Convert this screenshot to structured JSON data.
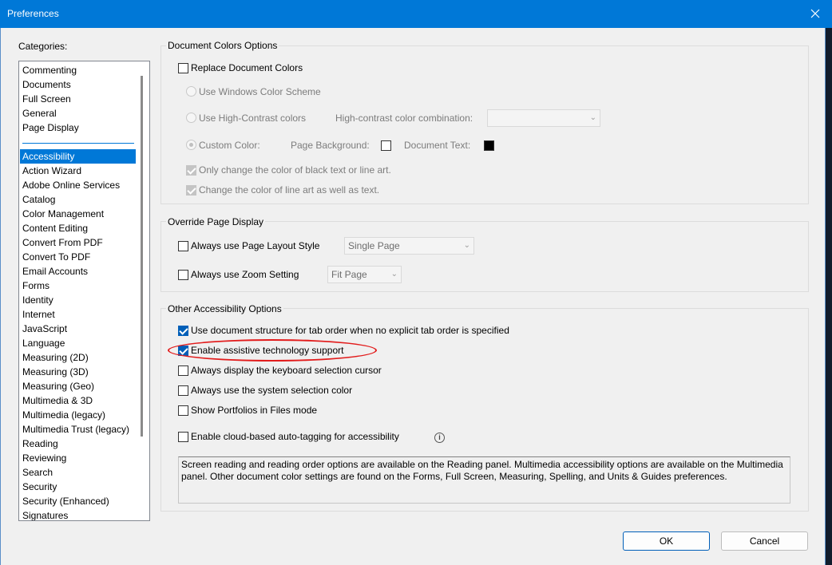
{
  "window": {
    "title": "Preferences",
    "accent": "#0078d7"
  },
  "categories": {
    "label": "Categories:",
    "top_items": [
      "Commenting",
      "Documents",
      "Full Screen",
      "General",
      "Page Display"
    ],
    "items": [
      "Accessibility",
      "Action Wizard",
      "Adobe Online Services",
      "Catalog",
      "Color Management",
      "Content Editing",
      "Convert From PDF",
      "Convert To PDF",
      "Email Accounts",
      "Forms",
      "Identity",
      "Internet",
      "JavaScript",
      "Language",
      "Measuring (2D)",
      "Measuring (3D)",
      "Measuring (Geo)",
      "Multimedia & 3D",
      "Multimedia (legacy)",
      "Multimedia Trust (legacy)",
      "Reading",
      "Reviewing",
      "Search",
      "Security",
      "Security (Enhanced)",
      "Signatures"
    ],
    "selected": "Accessibility"
  },
  "doc_colors": {
    "title": "Document Colors Options",
    "replace_label": "Replace Document Colors",
    "replace_checked": false,
    "use_windows_label": "Use Windows Color Scheme",
    "use_high_contrast_label": "Use High-Contrast colors",
    "high_contrast_combo_label": "High-contrast color combination:",
    "high_contrast_combo_value": "",
    "custom_color_label": "Custom Color:",
    "page_background_label": "Page Background:",
    "page_background_color": "#ffffff",
    "document_text_label": "Document Text:",
    "document_text_color": "#000000",
    "only_black_label": "Only change the color of black text or line art.",
    "line_art_label": "Change the color of line art as well as text."
  },
  "override": {
    "title": "Override Page Display",
    "page_layout_label": "Always use Page Layout Style",
    "page_layout_value": "Single Page",
    "zoom_label": "Always use Zoom Setting",
    "zoom_value": "Fit Page"
  },
  "other": {
    "title": "Other Accessibility Options",
    "options": [
      {
        "label": "Use document structure for tab order when no explicit tab order is specified",
        "checked": true
      },
      {
        "label": "Enable assistive technology support",
        "checked": true
      },
      {
        "label": "Always display the keyboard selection cursor",
        "checked": false
      },
      {
        "label": "Always use the system selection color",
        "checked": false
      },
      {
        "label": "Show Portfolios in Files mode",
        "checked": false
      }
    ],
    "cloud_label": "Enable cloud-based auto-tagging for accessibility",
    "cloud_checked": false,
    "info_icon": "info-icon",
    "note": "Screen reading and reading order options are available on the Reading panel. Multimedia accessibility options are available on the Multimedia panel. Other document color settings are found on the Forms, Full Screen, Measuring, Spelling, and Units & Guides preferences."
  },
  "buttons": {
    "ok": "OK",
    "cancel": "Cancel"
  },
  "annotation_color": "#e21c1c"
}
